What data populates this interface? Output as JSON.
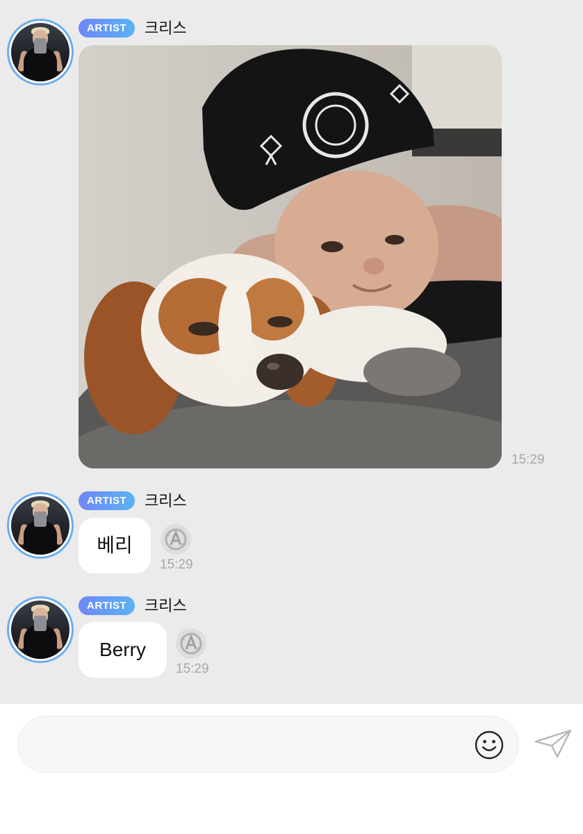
{
  "messages": [
    {
      "badge": "ARTIST",
      "sender": "크리스",
      "type": "image",
      "image_alt": "selfie with a Cavalier King Charles spaniel",
      "time": "15:29"
    },
    {
      "badge": "ARTIST",
      "sender": "크리스",
      "type": "text",
      "text": "베리",
      "time": "15:29"
    },
    {
      "badge": "ARTIST",
      "sender": "크리스",
      "type": "text",
      "text": "Berry",
      "time": "15:29"
    }
  ],
  "composer": {
    "placeholder": "",
    "emoji_icon": "smiley-icon",
    "send_icon": "paper-plane-icon"
  },
  "colors": {
    "background": "#ebebeb",
    "badge_start": "#6f86f7",
    "badge_end": "#5ab3f2",
    "avatar_ring": "#6aaef0",
    "timestamp": "#a7a7a7"
  }
}
